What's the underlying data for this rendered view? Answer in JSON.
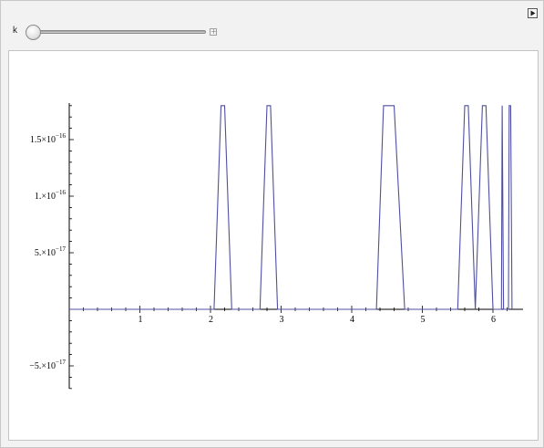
{
  "controls": {
    "slider_label": "k",
    "slider_value": 0,
    "play_icon": "play-triangle-icon",
    "plus_icon": "plus-icon"
  },
  "chart_data": {
    "type": "line",
    "title": "",
    "xlabel": "",
    "ylabel": "",
    "xlim": [
      0,
      6.4
    ],
    "ylim": [
      -7e-17,
      1.8e-16
    ],
    "x_ticks": [
      {
        "value": 1,
        "label": "1"
      },
      {
        "value": 2,
        "label": "2"
      },
      {
        "value": 3,
        "label": "3"
      },
      {
        "value": 4,
        "label": "4"
      },
      {
        "value": 5,
        "label": "5"
      },
      {
        "value": 6,
        "label": "6"
      }
    ],
    "y_ticks": [
      {
        "value": 1.5e-16,
        "mant": "1.5",
        "exp": "−16"
      },
      {
        "value": 1e-16,
        "mant": "1.",
        "exp": "−16"
      },
      {
        "value": 5e-17,
        "mant": "5.",
        "exp": "−17"
      },
      {
        "value": -5e-17,
        "mant": "−5.",
        "exp": "−17"
      }
    ],
    "line_color": "#4f4fa0",
    "series": [
      {
        "x": [
          0,
          2.05,
          2.15,
          2.2,
          2.3,
          2.7,
          2.8,
          2.85,
          2.95,
          4.35,
          4.45,
          4.6,
          4.75,
          5.5,
          5.6,
          5.65,
          5.75,
          5.85,
          5.9,
          6.0,
          6.12,
          6.13,
          6.15,
          6.22,
          6.23,
          6.25,
          6.27
        ],
        "y": [
          0,
          0,
          1.8e-16,
          1.8e-16,
          0,
          0,
          1.8e-16,
          1.8e-16,
          0,
          0,
          1.8e-16,
          1.8e-16,
          0,
          0,
          1.8e-16,
          1.8e-16,
          0,
          1.8e-16,
          1.8e-16,
          0,
          0,
          1.8e-16,
          0,
          0,
          1.8e-16,
          1.8e-16,
          0
        ]
      }
    ],
    "grid": false
  }
}
